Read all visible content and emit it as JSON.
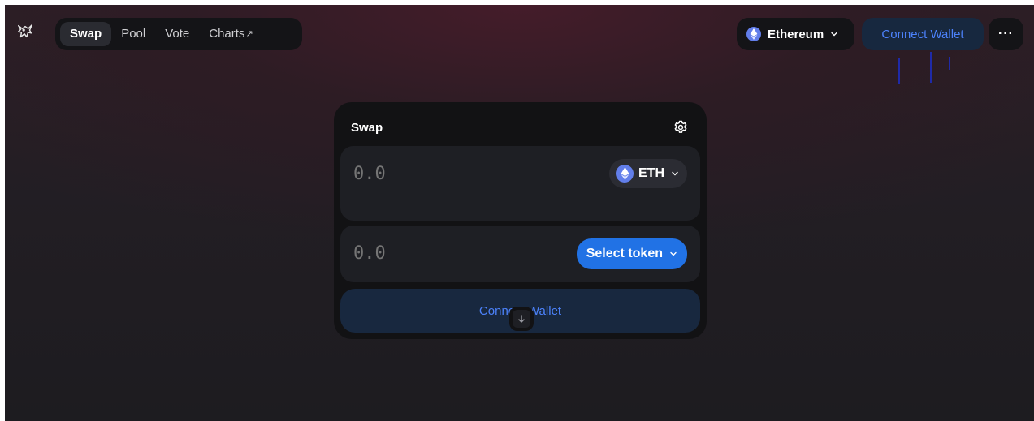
{
  "nav": {
    "tabs": [
      {
        "label": "Swap",
        "active": true
      },
      {
        "label": "Pool",
        "active": false
      },
      {
        "label": "Vote",
        "active": false
      },
      {
        "label": "Charts",
        "active": false,
        "external_marker": "↗"
      }
    ]
  },
  "header": {
    "network_label": "Ethereum",
    "connect_label": "Connect Wallet",
    "more_label": "···"
  },
  "swap": {
    "title": "Swap",
    "input_amount": "0.0",
    "input_token": "ETH",
    "output_amount": "0.0",
    "output_token_label": "Select token",
    "connect_label": "Connect Wallet"
  },
  "colors": {
    "accent_blue": "#2172e5",
    "connect_text": "#4c82fb",
    "connect_bg": "#17283f",
    "eth_purple": "#627eea"
  },
  "icons": [
    "unicorn-logo-icon",
    "ethereum-icon",
    "chevron-down-icon",
    "gear-icon",
    "arrow-down-icon",
    "ellipsis-icon"
  ]
}
